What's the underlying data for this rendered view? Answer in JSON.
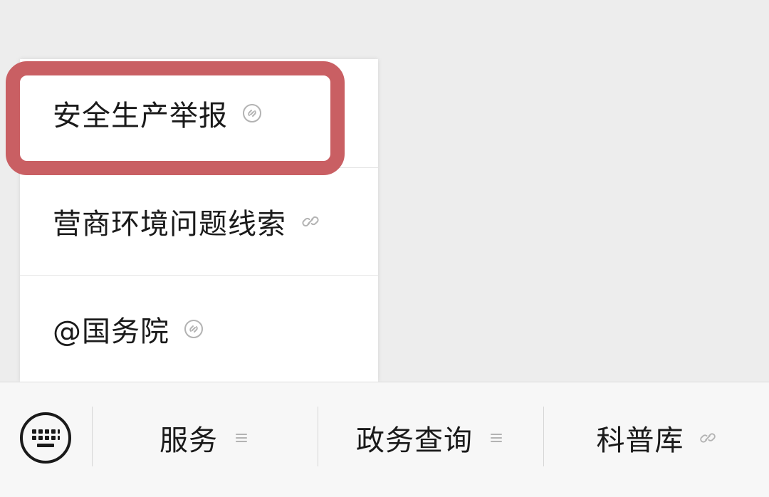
{
  "popup_menu": {
    "items": [
      {
        "label": "安全生产举报",
        "icon": "mini-program-icon"
      },
      {
        "label": "营商环境问题线索",
        "icon": "link-icon"
      },
      {
        "label": "@国务院",
        "icon": "mini-program-icon"
      }
    ],
    "highlighted_index": 0
  },
  "bottom_menu": {
    "keyboard_icon": "keyboard-icon",
    "items": [
      {
        "label": "服务",
        "icon": "submenu-lines-icon"
      },
      {
        "label": "政务查询",
        "icon": "submenu-lines-icon"
      },
      {
        "label": "科普库",
        "icon": "link-icon"
      }
    ]
  },
  "colors": {
    "highlight": "#c95f63",
    "background": "#ededed",
    "text": "#1a1a1a",
    "icon_gray": "#b3b3b3"
  }
}
